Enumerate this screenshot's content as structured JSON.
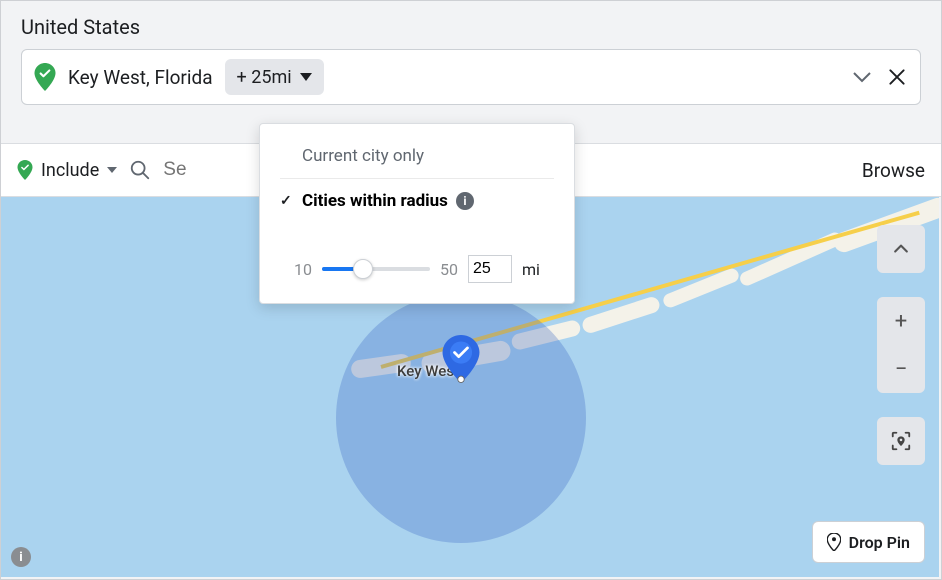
{
  "header": {
    "country": "United States"
  },
  "location_chip": {
    "icon": "map-pin-check-green",
    "name": "Key West, Florida",
    "radius_label": "+ 25mi"
  },
  "popover": {
    "option_current": "Current city only",
    "option_radius": "Cities within radius",
    "selected": "radius",
    "slider": {
      "min": "10",
      "max": "50",
      "value": "25",
      "unit": "mi"
    }
  },
  "toolbar": {
    "include_label": "Include",
    "search_placeholder": "Se",
    "browse_label": "Browse"
  },
  "map": {
    "marker_label": "Key West",
    "drop_pin_label": "Drop Pin"
  },
  "icons": {
    "info": "i",
    "plus": "+",
    "minus": "−"
  }
}
